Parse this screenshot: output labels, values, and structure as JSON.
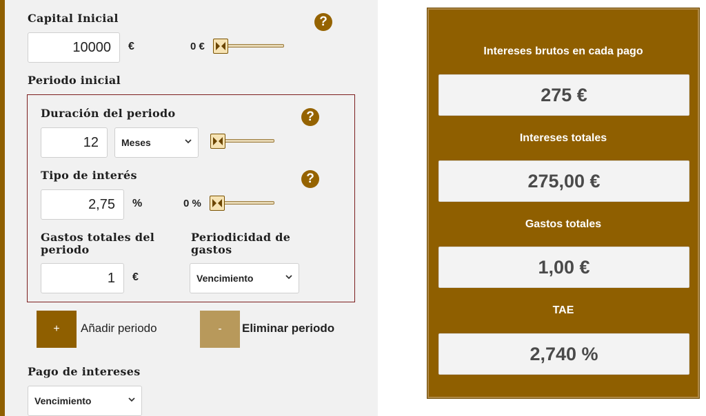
{
  "capital": {
    "label": "Capital Inicial",
    "value": "10000",
    "unit": "€",
    "slider_label": "0 €",
    "slider_level": 0
  },
  "periodo_inicial": {
    "label": "Periodo inicial",
    "duracion": {
      "label": "Duración del periodo",
      "value": "12",
      "unit_select": "Meses",
      "slider_level": 0
    },
    "tipo_interes": {
      "label": "Tipo de interés",
      "value": "2,75",
      "unit": "%",
      "slider_label": "0 %",
      "slider_level": 0
    },
    "gastos": {
      "label_line1": "Gastos totales del",
      "label_line2": "periodo",
      "value": "1",
      "unit": "€"
    },
    "periodicidad": {
      "label_line1": "Periodicidad de",
      "label_line2": "gastos",
      "selected": "Vencimiento"
    }
  },
  "buttons": {
    "add_symbol": "+",
    "add_label": "Añadir periodo",
    "remove_symbol": "-",
    "remove_label": "Eliminar periodo"
  },
  "pago_intereses": {
    "label": "Pago de intereses",
    "selected": "Vencimiento"
  },
  "help_glyph": "?",
  "results": {
    "intereses_brutos": {
      "title": "Intereses brutos en cada pago",
      "value": "275 €"
    },
    "intereses_totales": {
      "title": "Intereses totales",
      "value": "275,00 €"
    },
    "gastos_totales": {
      "title": "Gastos totales",
      "value": "1,00 €"
    },
    "tae": {
      "title": "TAE",
      "value": "2,740 %"
    }
  },
  "colors": {
    "brand_brown": "#8f5f00",
    "light_brown_button": "#b8995b",
    "panel_bg": "#f1f1f1",
    "period_border": "#7b1c1c"
  }
}
